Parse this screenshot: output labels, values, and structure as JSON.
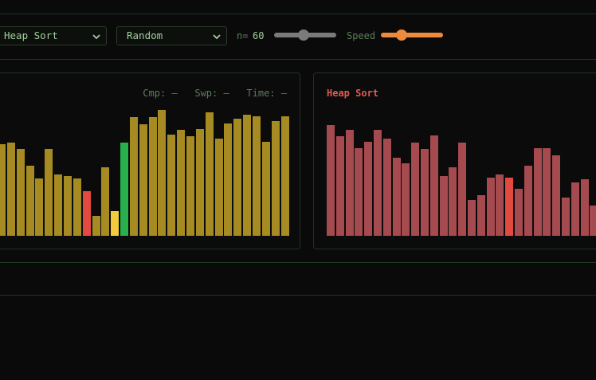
{
  "controls": {
    "algorithm": "Heap Sort",
    "pattern": "Random",
    "n_label": "n=",
    "n_value": "60",
    "n_slider_fraction": 0.48,
    "speed_label": "Speed",
    "speed_slider_fraction": 0.33
  },
  "left_panel": {
    "cmp_label": "Cmp:",
    "cmp_value": "—",
    "swp_label": "Swp:",
    "swp_value": "—",
    "time_label": "Time:",
    "time_value": "—",
    "bar_values": [
      115,
      117,
      109,
      88,
      72,
      109,
      77,
      75,
      72,
      56,
      25,
      86,
      31,
      117,
      149,
      140,
      149,
      158,
      127,
      133,
      125,
      134,
      155,
      122,
      141,
      147,
      152,
      150,
      118,
      144,
      150
    ],
    "highlights": {
      "9": "compare",
      "10": "default",
      "12": "swap",
      "13": "sorted"
    },
    "colors": {
      "default": "#a68a22",
      "compare": "#e24a3f",
      "swap": "#f2cc3d",
      "sorted": "#27b04b"
    }
  },
  "right_panel": {
    "title": "Heap Sort",
    "title_color": "#e25a56",
    "bar_values": [
      139,
      125,
      133,
      110,
      118,
      133,
      122,
      98,
      91,
      117,
      109,
      126,
      75,
      86,
      117,
      45,
      51,
      73,
      77,
      73,
      59,
      88,
      110,
      110,
      101,
      48,
      67,
      71,
      38
    ],
    "highlights": {
      "19": "compare"
    },
    "colors": {
      "default": "#a54a4f",
      "compare": "#e24a3f"
    }
  },
  "theme": {
    "slider_gray": "#7b7b7b",
    "slider_orange": "#ee8a3c"
  }
}
